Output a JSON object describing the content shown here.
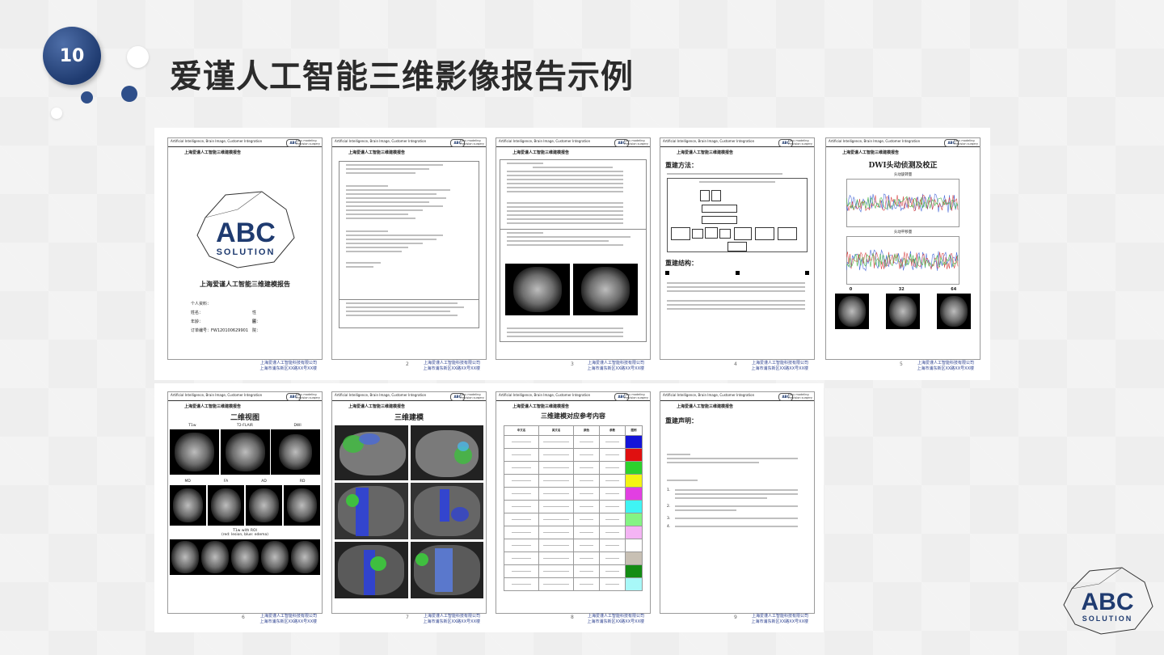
{
  "slide": {
    "number": "10",
    "title": "爱谨人工智能三维影像报告示例"
  },
  "common": {
    "header_left": "Artificial Intelligence, Brain Image, Customer Integration",
    "header_logo": "ABC",
    "header_tag_1": "Easy modeling",
    "header_tag_2": "Precision surgery",
    "report_name": "上海爱谨人工智能三维建模报告",
    "footer_company": "上海爱谨人工智能科技有限公司",
    "footer_address": "上海市浦东新区XX路XX号XX楼"
  },
  "pages": [
    {
      "num": "",
      "title": "上海爱谨人工智能三维建模报告",
      "logo": "ABC",
      "logo_sub": "SOLUTION",
      "fields": [
        "个人资料：",
        "姓名：",
        "性别：",
        "年龄：",
        "医院：",
        "订单编号：FW120100629901"
      ]
    },
    {
      "num": "2",
      "title": "上海爱谨人工智能三维建模报告"
    },
    {
      "num": "3",
      "title": "上海爱谨人工智能三维建模报告"
    },
    {
      "num": "4",
      "title": "上海爱谨人工智能三维建模报告",
      "sections": [
        "重建方法：",
        "重建结构："
      ]
    },
    {
      "num": "5",
      "title": "上海爱谨人工智能三维建模报告",
      "heading": "DWI头动侦测及校正",
      "sub1": "头动旋转量",
      "sub2": "头动平移量",
      "labels": [
        "0",
        "32",
        "64"
      ]
    },
    {
      "num": "6",
      "title": "上海爱谨人工智能三维建模报告",
      "heading": "二维视图",
      "labels_row1": [
        "T1w",
        "T2-FLAIR",
        "DWI"
      ],
      "labels_row2": [
        "MD",
        "FA",
        "AD",
        "RD"
      ],
      "sub": "T1w with ROI",
      "sub2": "(red: lesion, blue: edema)"
    },
    {
      "num": "7",
      "title": "上海爱谨人工智能三维建模报告",
      "heading": "三维建模"
    },
    {
      "num": "8",
      "title": "上海爱谨人工智能三维建模报告",
      "heading": "三维建模对应参考内容",
      "cols": [
        "中文名",
        "英文名",
        "颜色",
        "参数",
        "图例"
      ],
      "colors": [
        "#1414d8",
        "#e01010",
        "#2dd22d",
        "#f4f414",
        "#e23fe2",
        "#3ff4f4",
        "#84f484",
        "#f4b4f4",
        "#ffffff",
        "#c8c0b4",
        "#148c14",
        "#a8f8f8"
      ]
    },
    {
      "num": "9",
      "title": "上海爱谨人工智能三维建模报告",
      "heading": "重建声明：",
      "items": [
        "1.",
        "2.",
        "3.",
        "4."
      ]
    }
  ],
  "colors": {
    "accent": "#1f3b70",
    "footer_blue": "#2a3f8f"
  }
}
